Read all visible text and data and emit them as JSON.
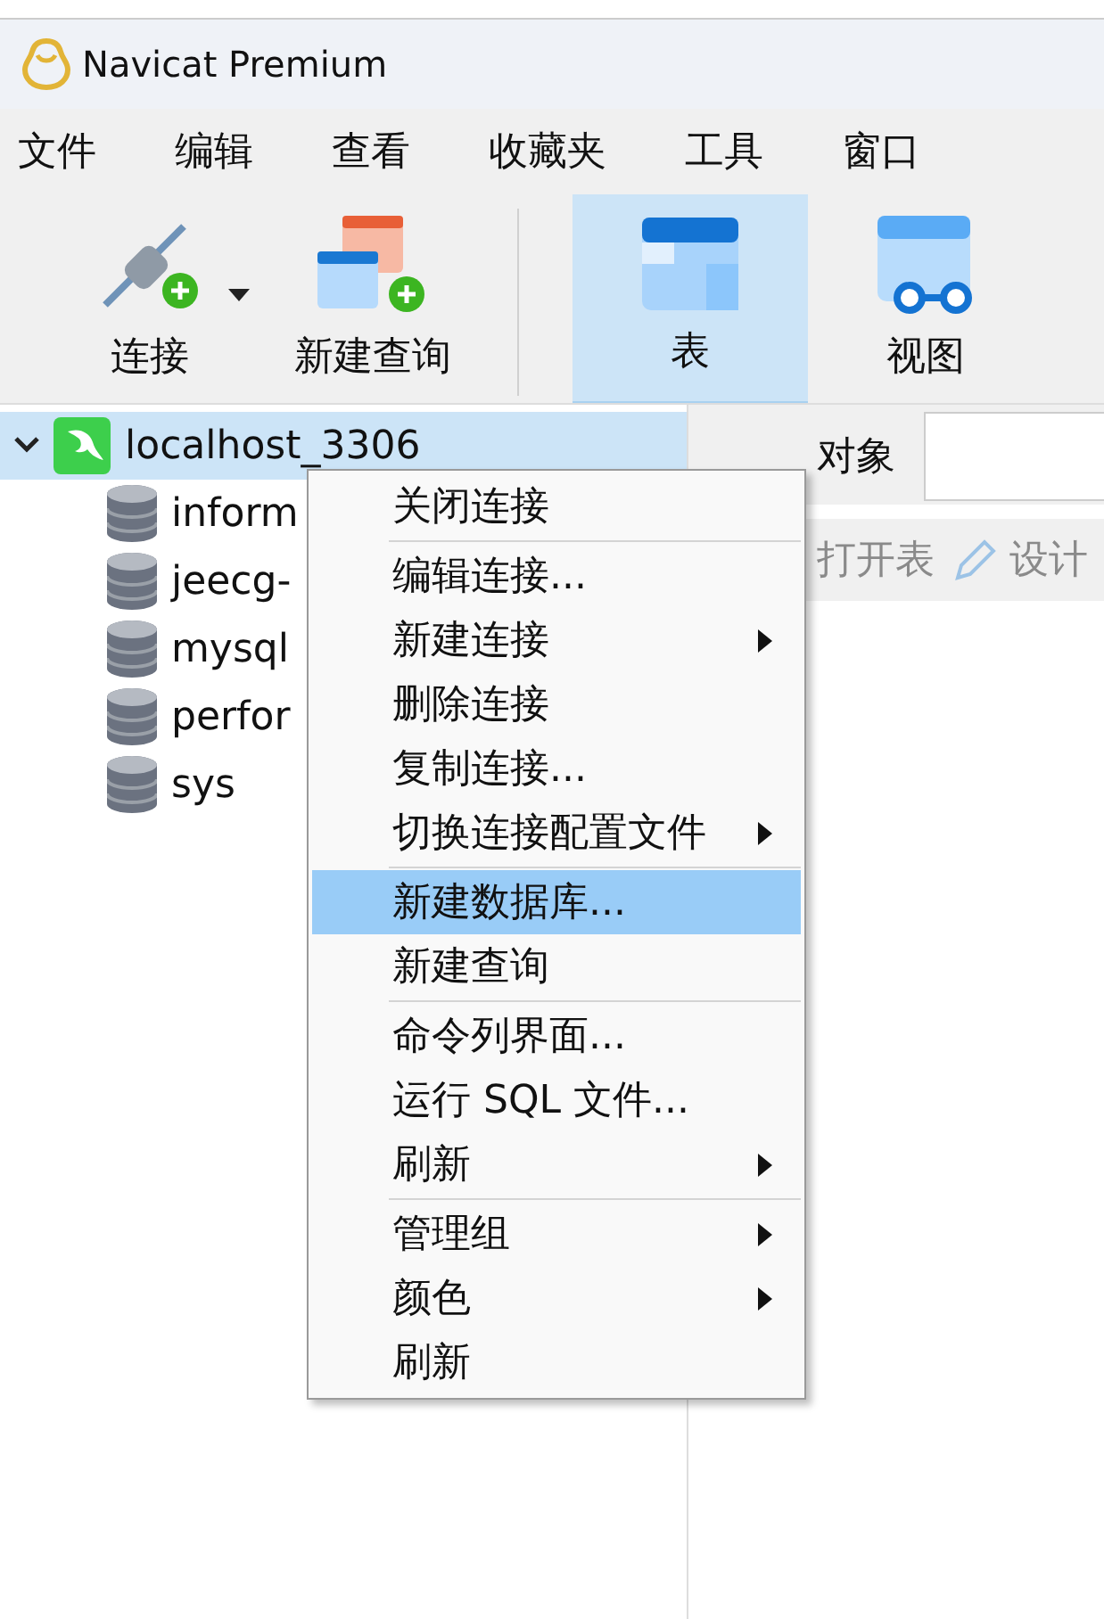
{
  "window": {
    "title": "Navicat Premium"
  },
  "menu_bar": [
    "文件",
    "编辑",
    "查看",
    "收藏夹",
    "工具",
    "窗口"
  ],
  "toolbar": [
    {
      "label": "连接",
      "kind": "plug",
      "dropdown": true,
      "selected": false
    },
    {
      "label": "新建查询",
      "kind": "query",
      "dropdown": false,
      "selected": false
    },
    {
      "label": "表",
      "kind": "table",
      "dropdown": false,
      "selected": true
    },
    {
      "label": "视图",
      "kind": "view",
      "dropdown": false,
      "selected": false
    }
  ],
  "tree": [
    {
      "label": "localhost_3306",
      "expanded": true,
      "selected": true,
      "children": [
        {
          "label": "inform"
        },
        {
          "label": "jeecg-"
        },
        {
          "label": "mysql"
        },
        {
          "label": "perfor"
        },
        {
          "label": "sys"
        }
      ]
    }
  ],
  "object_tab": {
    "label": "对象"
  },
  "object_toolbar": [
    "打开表",
    "设计"
  ],
  "context_menu": {
    "groups": [
      [
        {
          "label": "关闭连接",
          "submenu": false,
          "selected": false
        }
      ],
      [
        {
          "label": "编辑连接...",
          "submenu": false,
          "selected": false
        },
        {
          "label": "新建连接",
          "submenu": true,
          "selected": false
        },
        {
          "label": "删除连接",
          "submenu": false,
          "selected": false
        },
        {
          "label": "复制连接...",
          "submenu": false,
          "selected": false
        },
        {
          "label": "切换连接配置文件",
          "submenu": true,
          "selected": false
        }
      ],
      [
        {
          "label": "新建数据库...",
          "submenu": false,
          "selected": true
        },
        {
          "label": "新建查询",
          "submenu": false,
          "selected": false
        }
      ],
      [
        {
          "label": "命令列界面...",
          "submenu": false,
          "selected": false
        },
        {
          "label": "运行 SQL 文件...",
          "submenu": false,
          "selected": false
        },
        {
          "label": "刷新",
          "submenu": true,
          "selected": false
        }
      ],
      [
        {
          "label": "管理组",
          "submenu": true,
          "selected": false
        },
        {
          "label": "颜色",
          "submenu": true,
          "selected": false
        },
        {
          "label": "刷新",
          "submenu": false,
          "selected": false
        }
      ]
    ]
  }
}
